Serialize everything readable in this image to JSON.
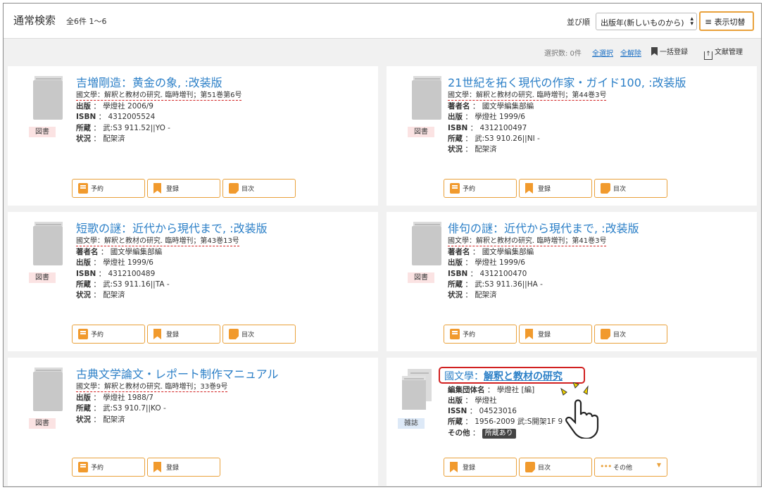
{
  "header": {
    "title": "通常検索",
    "count": "全6件 1〜6",
    "sort_label": "並び順",
    "sort_value": "出版年(新しいものから)",
    "view_toggle": "表示切替"
  },
  "toolbar": {
    "selected": "選択数: 0件",
    "select_all": "全選択",
    "deselect_all": "全解除",
    "bulk_register": "一括登録",
    "doc_manage": "文献管理"
  },
  "labels": {
    "author": "著者名",
    "publish": "出版",
    "isbn": "ISBN",
    "issn": "ISSN",
    "holding": "所蔵",
    "status": "状況",
    "editor_org": "編集団体名",
    "other": "その他",
    "sep": "："
  },
  "buttons": {
    "reserve": "予約",
    "register": "登録",
    "toc": "目次",
    "other": "その他"
  },
  "cards": [
    {
      "type": "図書",
      "title": "吉増剛造：黄金の象, :改装版",
      "series": "國文學：解釈と教材の研究. 臨時増刊；第51巻第6号",
      "publish": "學燈社 2006/9",
      "isbn": "4312005524",
      "holding": "武:S3 911.52||YO -",
      "status": "配架済"
    },
    {
      "type": "図書",
      "title": "21世紀を拓く現代の作家・ガイド100, :改装版",
      "series": "國文學：解釈と教材の研究. 臨時増刊；第44巻3号",
      "author": "國文學編集部編",
      "publish": "學燈社 1999/6",
      "isbn": "4312100497",
      "holding": "武:S3 910.26||NI -",
      "status": "配架済"
    },
    {
      "type": "図書",
      "title": "短歌の謎：近代から現代まで, :改装版",
      "series": "國文學：解釈と教材の研究. 臨時増刊；第43巻13号",
      "author": "國文學編集部編",
      "publish": "學燈社 1999/6",
      "isbn": "4312100489",
      "holding": "武:S3 911.16||TA -",
      "status": "配架済"
    },
    {
      "type": "図書",
      "title": "俳句の謎：近代から現代まで, :改装版",
      "series": "國文學：解釈と教材の研究. 臨時増刊；第41巻3号",
      "author": "國文學編集部編",
      "publish": "學燈社 1999/6",
      "isbn": "4312100470",
      "holding": "武:S3 911.36||HA -",
      "status": "配架済"
    },
    {
      "type": "図書",
      "title": "古典文学論文・レポート制作マニュアル",
      "series": "國文學：解釈と教材の研究. 臨時増刊；33巻9号",
      "publish": "學燈社 1988/7",
      "holding": "武:S3 910.7||KO -",
      "status": "配架済"
    },
    {
      "type": "雑誌",
      "title_prefix": "國文學：",
      "title_link": "解釈と教材の研究",
      "editor_org": "學燈社 [編]",
      "publish": "學燈社",
      "issn": "04523016",
      "holding": "1956-2009 武:S開架1F 9",
      "other_tag": "所蔵あり"
    }
  ],
  "colors": {
    "accent": "#e9a13b",
    "link": "#2b7fc7",
    "highlight": "#d12020"
  }
}
